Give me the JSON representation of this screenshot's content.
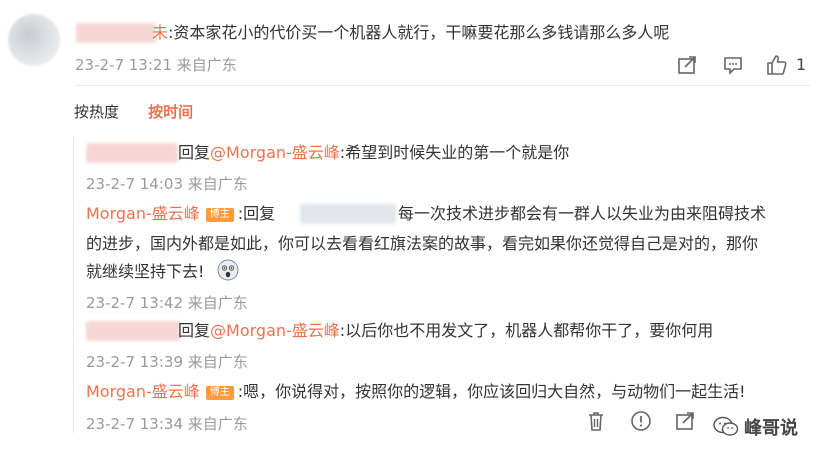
{
  "comment": {
    "user_suffix": "未",
    "text": ":资本家花小的代价买一个机器人就行，干嘛要花那么多钱请那么多人呢",
    "meta": "23-2-7 13:21 来自广东",
    "like_count": "1"
  },
  "tabs": {
    "hot": "按热度",
    "time": "按时间"
  },
  "replies": [
    {
      "prefix": "回复",
      "mention": "@Morgan-盛云峰",
      "text": ":希望到时候失业的第一个就是你",
      "meta": "23-2-7 14:03 来自广东"
    },
    {
      "author": "Morgan-盛云峰",
      "badge": "博主",
      "text_before": ":回复",
      "text_after": "每一次技术进步都会有一群人以失业为由来阻碍技术",
      "line2": "的进步，国内外都是如此，你可以去看看红旗法案的故事，看完如果你还觉得自己是对的，那你",
      "line3": "就继续坚持下去!",
      "meta": "23-2-7 13:42 来自广东"
    },
    {
      "prefix": "回复",
      "mention": "@Morgan-盛云峰",
      "text": ":以后你也不用发文了，机器人都帮你干了，要你何用",
      "meta": "23-2-7 13:39 来自广东"
    },
    {
      "author": "Morgan-盛云峰",
      "badge": "博主",
      "text": ":嗯，你说得对，按照你的逻辑，你应该回归大自然，与动物们一起生活!",
      "meta": "23-2-7 13:34 来自广东"
    }
  ],
  "watermark": "峰哥说",
  "colors": {
    "accent": "#eb7350",
    "badge": "#ff9a3c",
    "meta": "#9a9a9a"
  }
}
